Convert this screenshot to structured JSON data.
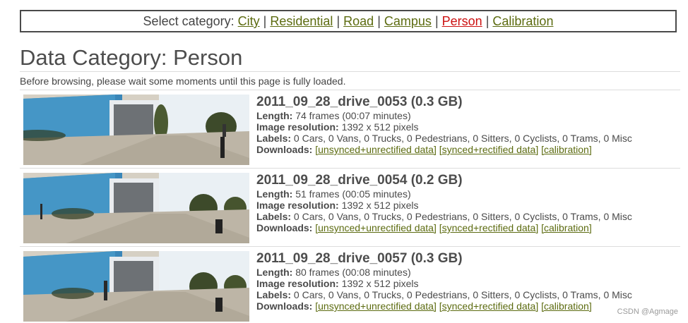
{
  "nav": {
    "prefix": "Select category:",
    "items": [
      {
        "label": "City",
        "active": false
      },
      {
        "label": "Residential",
        "active": false
      },
      {
        "label": "Road",
        "active": false
      },
      {
        "label": "Campus",
        "active": false
      },
      {
        "label": "Person",
        "active": true
      },
      {
        "label": "Calibration",
        "active": false
      }
    ],
    "separator": "|"
  },
  "page": {
    "title": "Data Category: Person",
    "notice": "Before browsing, please wait some moments until this page is fully loaded."
  },
  "labels": {
    "length": "Length:",
    "resolution": "Image resolution:",
    "labels": "Labels:",
    "downloads": "Downloads:"
  },
  "entries": [
    {
      "title": "2011_09_28_drive_0053 (0.3 GB)",
      "length": "74 frames (00:07 minutes)",
      "resolution": "1392 x 512 pixels",
      "labels": "0 Cars, 0 Vans, 0 Trucks, 0 Pedestrians, 0 Sitters, 0 Cyclists, 0 Trams, 0 Misc",
      "downloads": [
        "[unsynced+unrectified data]",
        "[synced+rectified data]",
        "[calibration]"
      ]
    },
    {
      "title": "2011_09_28_drive_0054 (0.2 GB)",
      "length": "51 frames (00:05 minutes)",
      "resolution": "1392 x 512 pixels",
      "labels": "0 Cars, 0 Vans, 0 Trucks, 0 Pedestrians, 0 Sitters, 0 Cyclists, 0 Trams, 0 Misc",
      "downloads": [
        "[unsynced+unrectified data]",
        "[synced+rectified data]",
        "[calibration]"
      ]
    },
    {
      "title": "2011_09_28_drive_0057 (0.3 GB)",
      "length": "80 frames (00:08 minutes)",
      "resolution": "1392 x 512 pixels",
      "labels": "0 Cars, 0 Vans, 0 Trucks, 0 Pedestrians, 0 Sitters, 0 Cyclists, 0 Trams, 0 Misc",
      "downloads": [
        "[unsynced+unrectified data]",
        "[synced+rectified data]",
        "[calibration]"
      ]
    }
  ],
  "watermark": "CSDN @Agmage",
  "colors": {
    "link": "#5c6b10",
    "active_link": "#cc1111",
    "text": "#4a4a4a"
  }
}
